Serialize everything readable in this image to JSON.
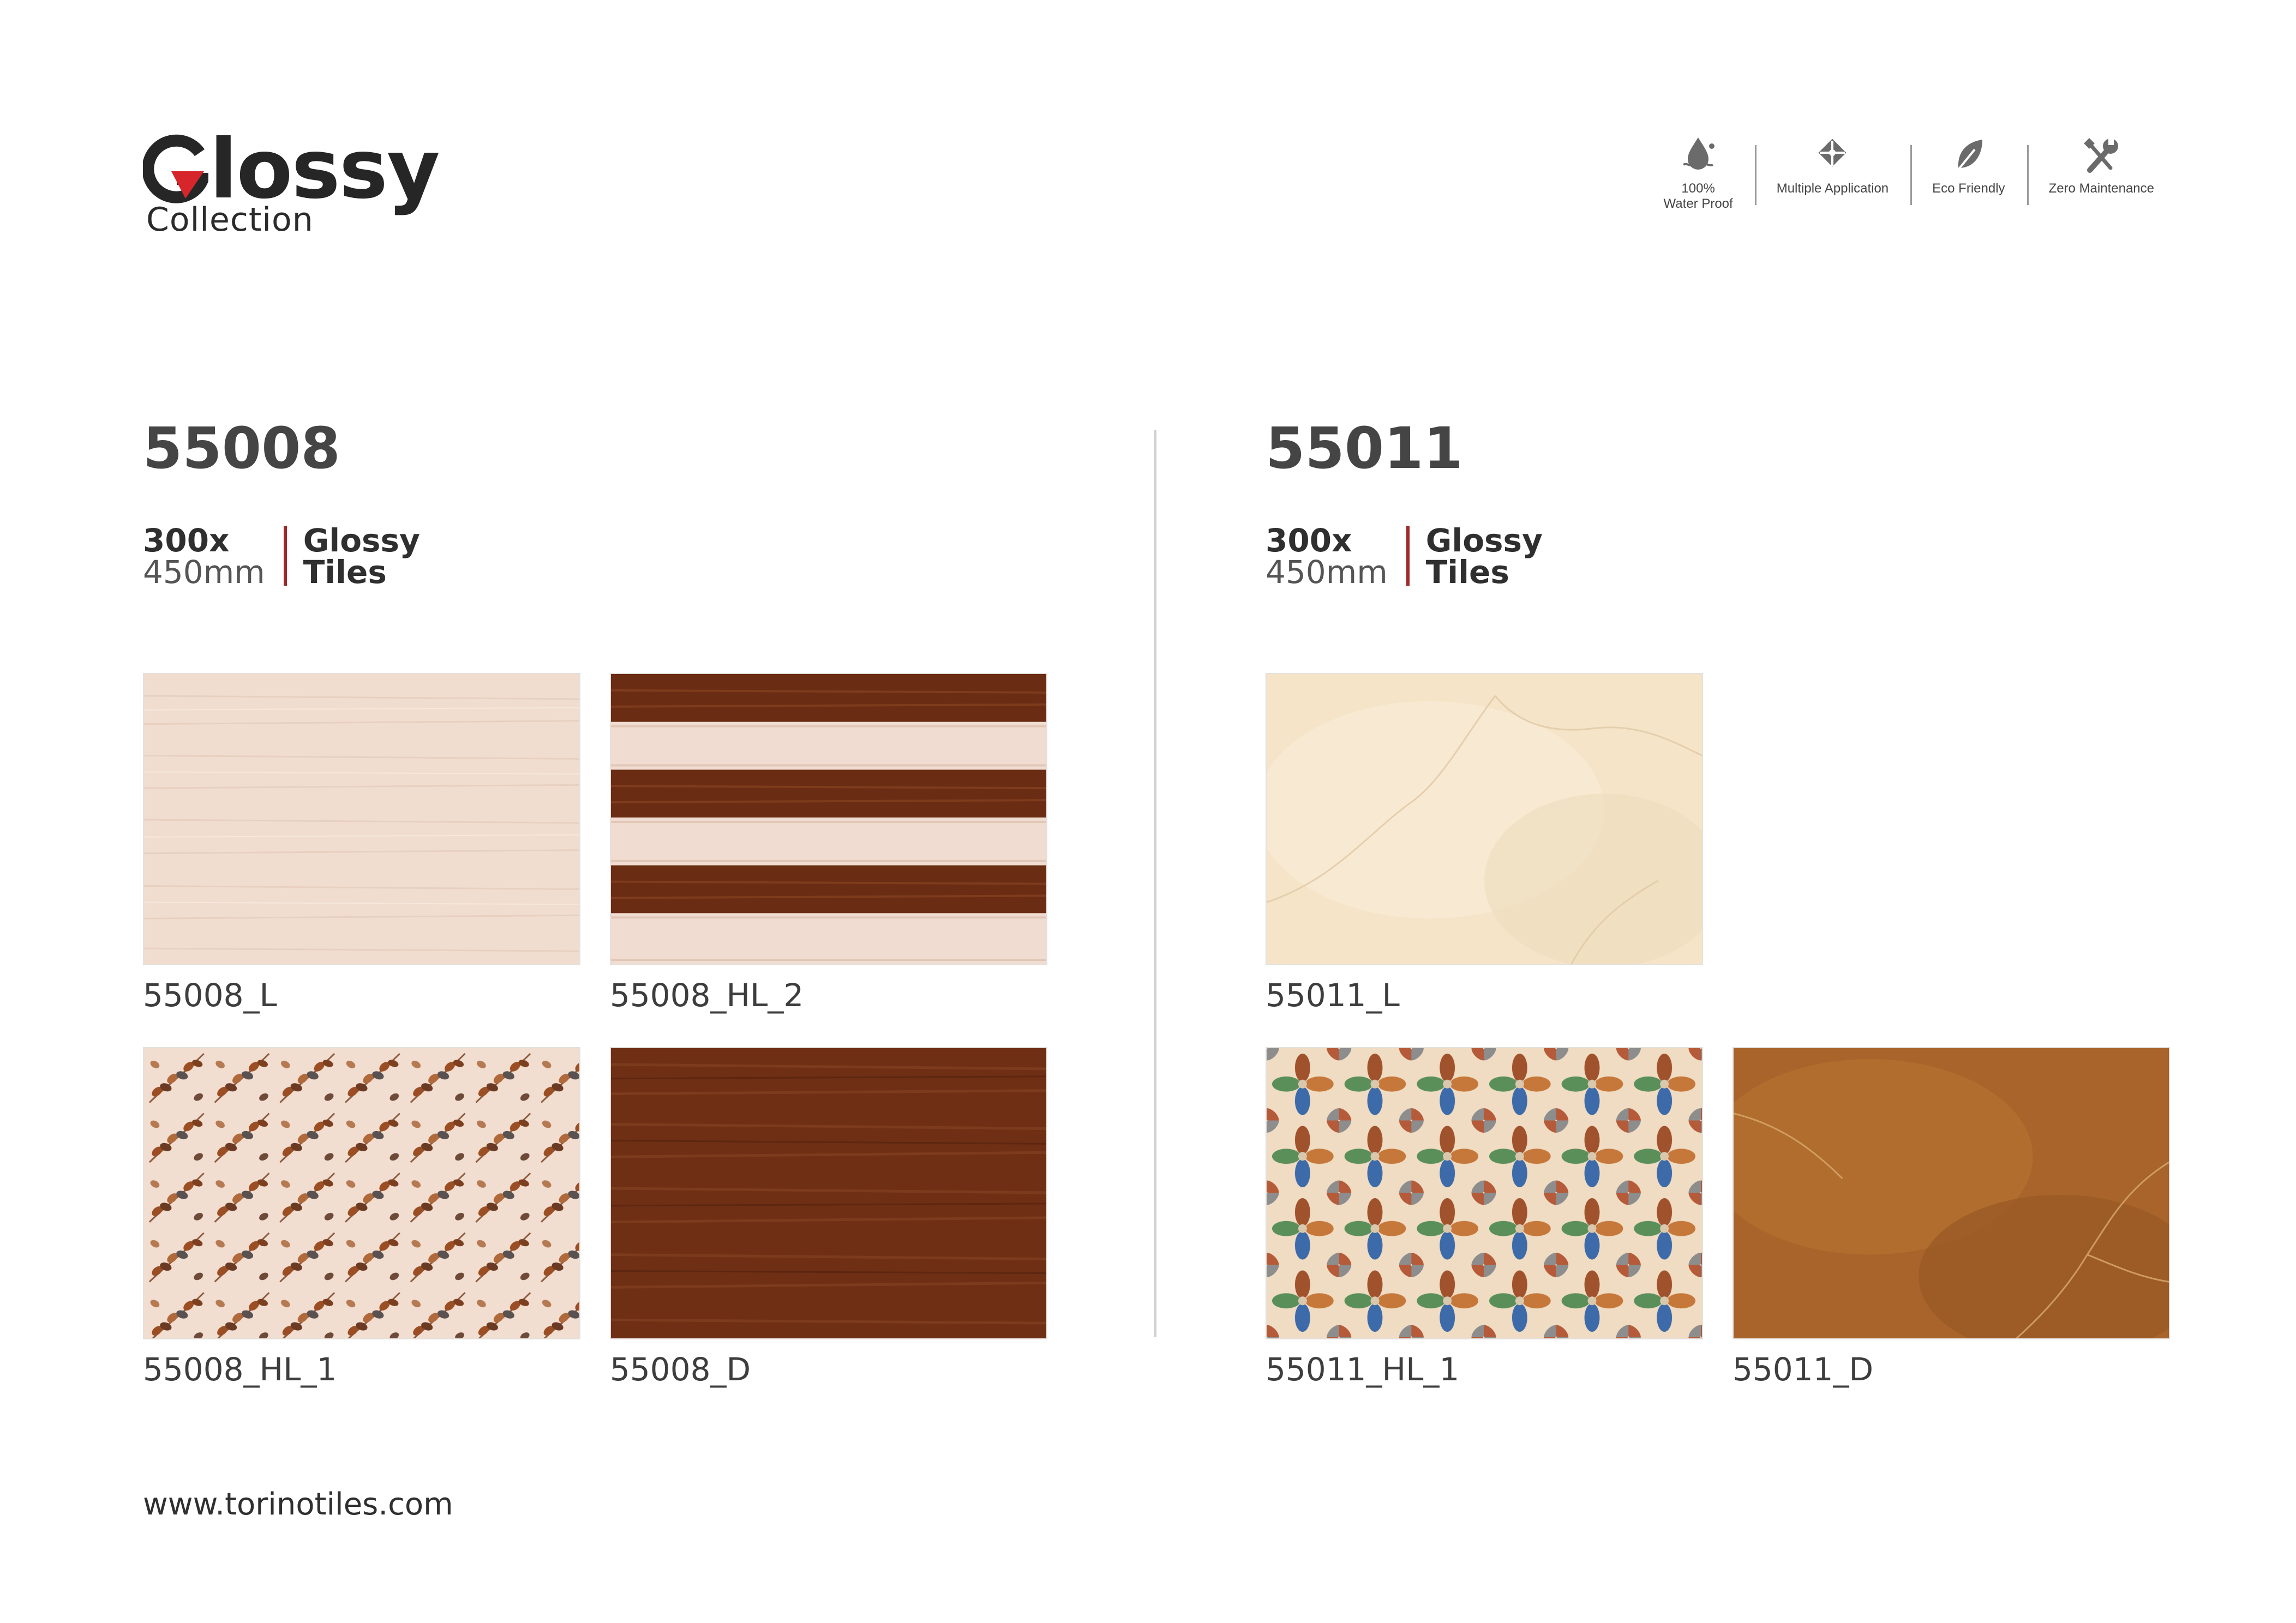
{
  "brand": {
    "title": "Glossy",
    "title_rest": "lossy",
    "subtitle": "Collection",
    "accent_color": "#d7262b"
  },
  "features": [
    {
      "icon": "water-drop-icon",
      "label": "100%\nWater Proof"
    },
    {
      "icon": "multiple-application-icon",
      "label": "Multiple Application"
    },
    {
      "icon": "leaf-icon",
      "label": "Eco Friendly"
    },
    {
      "icon": "wrench-screwdriver-icon",
      "label": "Zero Maintenance"
    }
  ],
  "sections": [
    {
      "code": "55008",
      "size_line1": "300x",
      "size_line2": "450mm",
      "type_line1": "Glossy",
      "type_line2": "Tiles",
      "tiles": [
        {
          "name": "55008_L"
        },
        {
          "name": "55008_HL_2"
        },
        {
          "name": "55008_HL_1"
        },
        {
          "name": "55008_D"
        }
      ]
    },
    {
      "code": "55011",
      "size_line1": "300x",
      "size_line2": "450mm",
      "type_line1": "Glossy",
      "type_line2": "Tiles",
      "tiles": [
        {
          "name": "55011_L"
        },
        {
          "name": "55011_HL_1"
        },
        {
          "name": "55011_D"
        }
      ]
    }
  ],
  "footer": {
    "website": "www.torinotiles.com"
  }
}
